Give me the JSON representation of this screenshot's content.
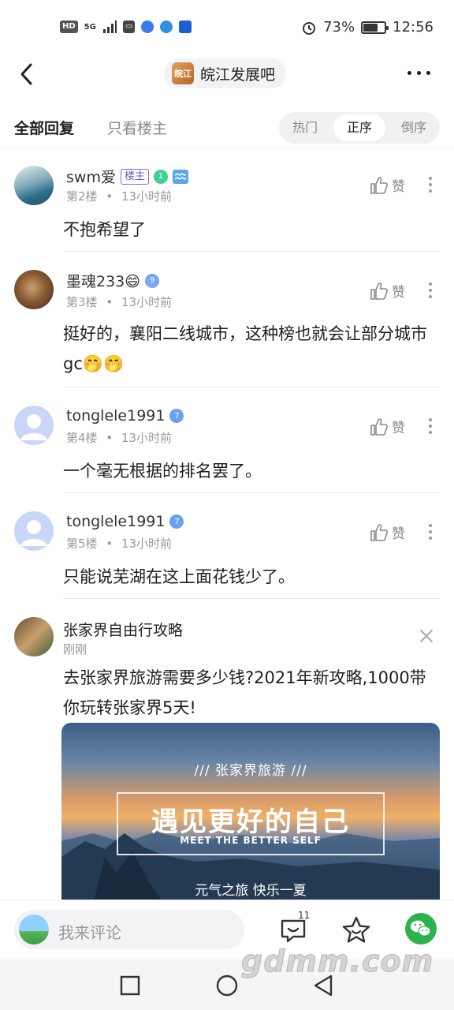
{
  "status": {
    "network": "5G",
    "battery": "73%",
    "battery_level": 0.73,
    "time": "12:56"
  },
  "nav": {
    "forum_name": "皖江发展吧",
    "forum_logo_text": "皖江"
  },
  "tabs": {
    "all": "全部回复",
    "op_only": "只看楼主"
  },
  "sort": {
    "hot": "热门",
    "asc": "正序",
    "desc": "倒序",
    "selected": "正序"
  },
  "like_label": "赞",
  "comments": [
    {
      "user": "swm爱",
      "host_badge": "楼主",
      "level": "1",
      "floor": "第2楼",
      "time": "13小时前",
      "text": "不抱希望了"
    },
    {
      "user": "墨魂233😄",
      "level": "9",
      "floor": "第3楼",
      "time": "13小时前",
      "text": "挺好的，襄阳二线城市，这种榜也就会让部分城市gc🤭🤭"
    },
    {
      "user": "tonglele1991",
      "level": "7",
      "floor": "第4楼",
      "time": "13小时前",
      "text": "一个毫无根据的排名罢了。"
    },
    {
      "user": "tonglele1991",
      "level": "7",
      "floor": "第5楼",
      "time": "13小时前",
      "text": "只能说芜湖在这上面花钱少了。"
    }
  ],
  "meta_sep": "•",
  "ad": {
    "name": "张家界自由行攻略",
    "time": "刚刚",
    "text": "去张家界旅游需要多少钱?2021年新攻略,1000带你玩转张家界5天!",
    "banner_sub": "/// 张家界旅游 ///",
    "banner_title": "遇见更好的自己",
    "banner_en": "MEET THE BETTER SELF",
    "banner_bottom": "元气之旅 快乐一夏"
  },
  "bottom": {
    "placeholder": "我来评论",
    "comment_count": "11"
  },
  "watermark": "gdmm.com"
}
